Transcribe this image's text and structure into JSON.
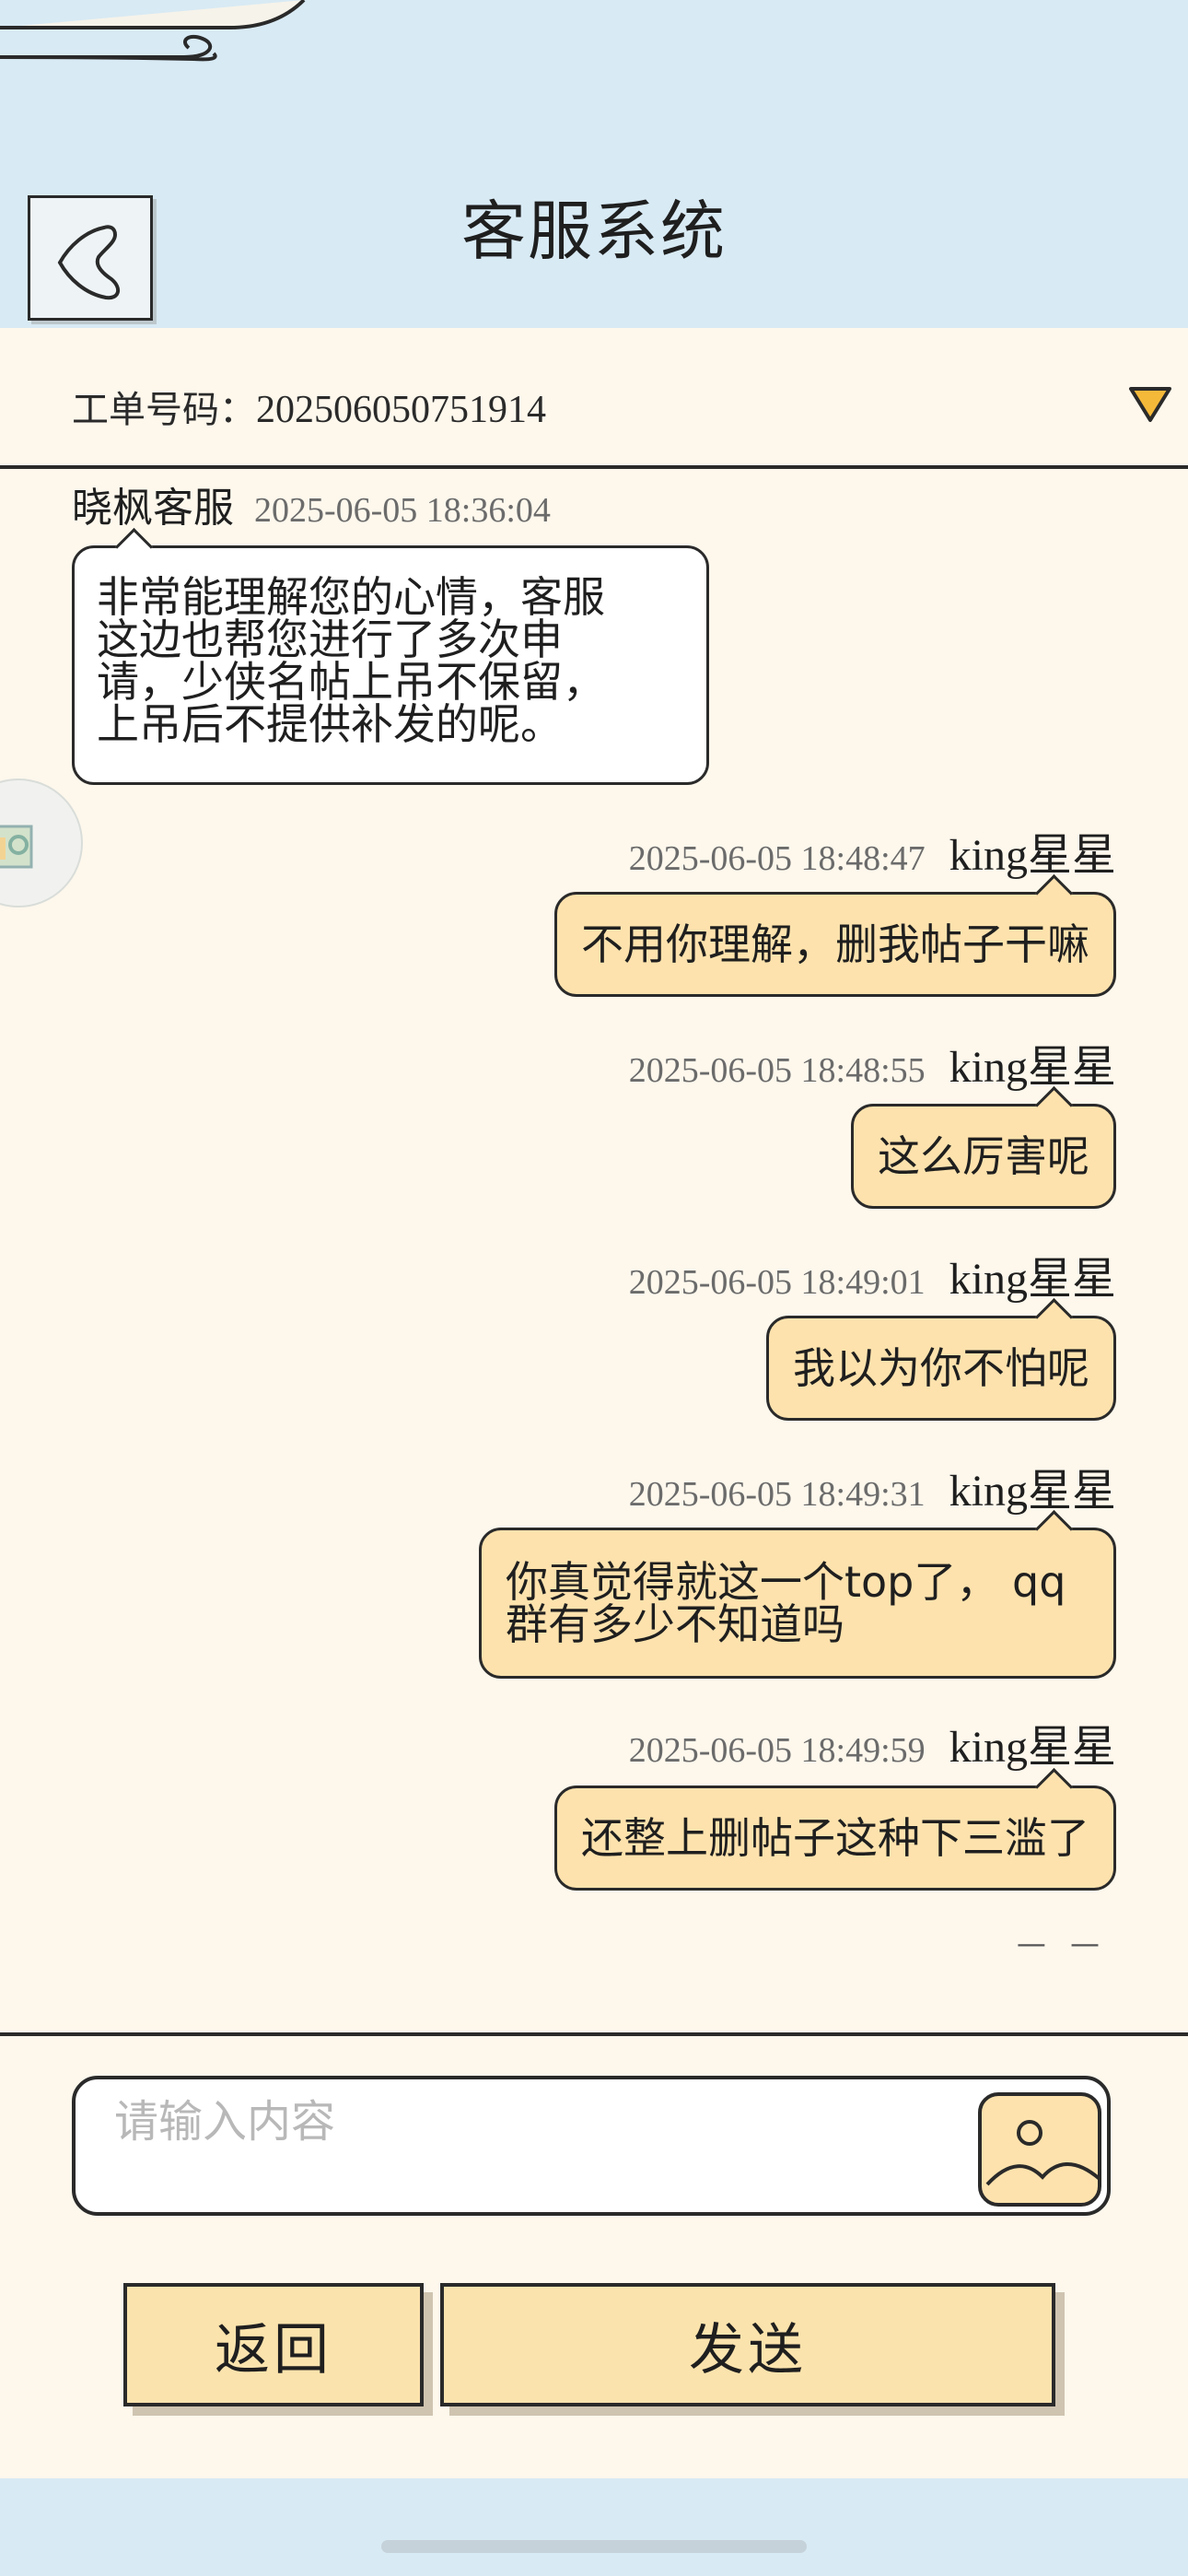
{
  "header": {
    "title": "客服系统"
  },
  "ticket": {
    "label": "工单号码：",
    "number": "202506050751914"
  },
  "messages": [
    {
      "role": "agent",
      "sender": "晓枫客服",
      "time": "2025-06-05 18:36:04",
      "lines": [
        "非常能理解您的心情，客服",
        "这边也帮您进行了多次申",
        "请，少侠名帖上吊不保留，",
        "上吊后不提供补发的呢。"
      ]
    },
    {
      "role": "user",
      "sender": "king星星",
      "time": "2025-06-05 18:48:47",
      "lines": [
        "不用你理解，删我帖子干嘛"
      ]
    },
    {
      "role": "user",
      "sender": "king星星",
      "time": "2025-06-05 18:48:55",
      "lines": [
        "这么厉害呢"
      ]
    },
    {
      "role": "user",
      "sender": "king星星",
      "time": "2025-06-05 18:49:01",
      "lines": [
        "我以为你不怕呢"
      ]
    },
    {
      "role": "user",
      "sender": "king星星",
      "time": "2025-06-05 18:49:31",
      "lines": [
        "你真觉得就这一个top了， qq",
        "群有多少不知道吗"
      ]
    },
    {
      "role": "user",
      "sender": "king星星",
      "time": "2025-06-05 18:49:59",
      "lines": [
        "还整上删帖子这种下三滥了"
      ]
    }
  ],
  "typing_indicator": "— —",
  "composer": {
    "placeholder": "请输入内容"
  },
  "buttons": {
    "back_label": "返回",
    "send_label": "发送"
  },
  "colors": {
    "header_bg": "#d8eaf4",
    "page_bg": "#fdf7ec",
    "user_bubble": "#fde2ad",
    "agent_bubble": "#ffffff",
    "dropdown_accent": "#f5b93a"
  },
  "icons": {
    "back": "chevron-left-icon",
    "dropdown": "triangle-down-icon",
    "image": "image-picture-icon",
    "floating": "floating-widget-icon"
  }
}
